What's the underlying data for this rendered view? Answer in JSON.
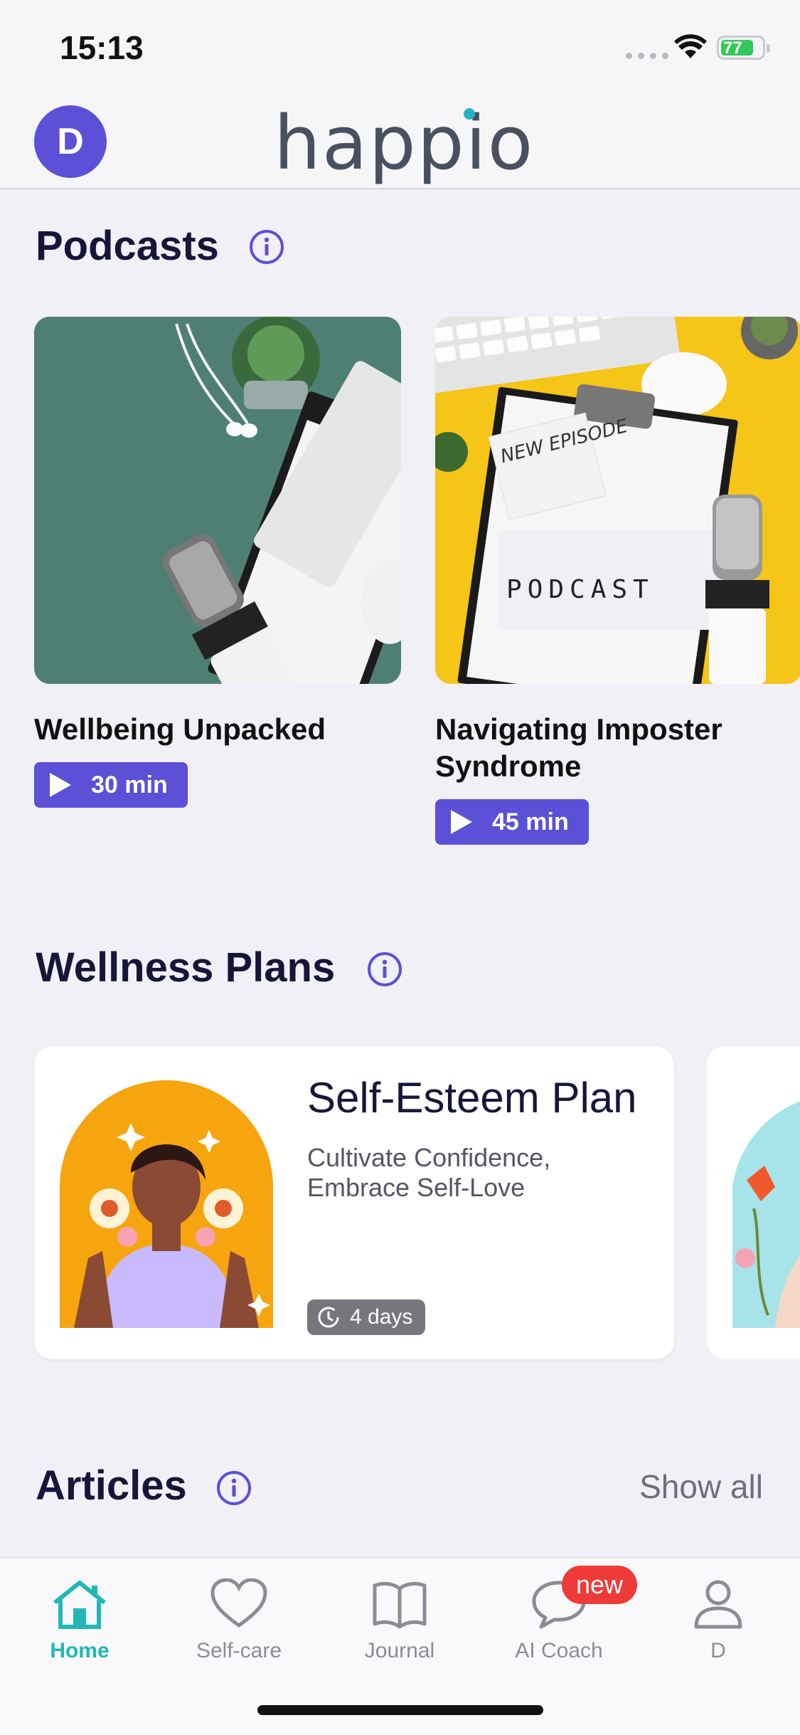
{
  "status": {
    "time": "15:13",
    "battery": "77"
  },
  "header": {
    "avatar_letter": "D",
    "logo": "happio"
  },
  "podcasts": {
    "title": "Podcasts",
    "items": [
      {
        "title": "Wellbeing Unpacked",
        "duration": "30 min"
      },
      {
        "title": "Navigating Imposter Syndrome",
        "duration": "45 min",
        "image_text_top": "NEW EPISODE",
        "image_text_box": "PODCAST"
      }
    ]
  },
  "wellness": {
    "title": "Wellness Plans",
    "plan": {
      "title": "Self-Esteem Plan",
      "subtitle": "Cultivate Confidence, Embrace Self-Love",
      "duration": "4 days"
    }
  },
  "articles": {
    "title": "Articles",
    "show_all": "Show all"
  },
  "tabs": [
    {
      "label": "Home",
      "icon": "home-icon",
      "active": true
    },
    {
      "label": "Self-care",
      "icon": "heart-icon"
    },
    {
      "label": "Journal",
      "icon": "book-icon"
    },
    {
      "label": "AI Coach",
      "icon": "chat-icon",
      "badge": "new"
    },
    {
      "label": "D",
      "icon": "profile-icon"
    }
  ],
  "colors": {
    "accent": "#5b50d6",
    "active_tab": "#22b7b7",
    "badge": "#ef3a3a"
  }
}
